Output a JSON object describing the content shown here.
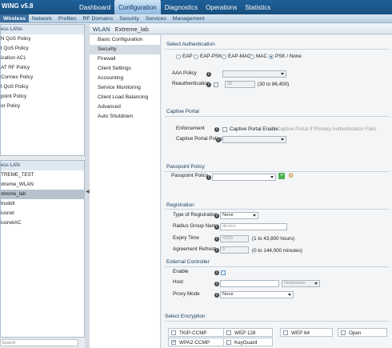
{
  "app": {
    "brand": "WiNG v5.8"
  },
  "main_nav": [
    "Dashboard",
    "Configuration",
    "Diagnostics",
    "Operations",
    "Statistics"
  ],
  "sub_nav": [
    "Wireless",
    "Network",
    "Profiles",
    "RF Domains",
    "Security",
    "Services",
    "Management"
  ],
  "left_top": {
    "header": "ess LANs",
    "items": [
      "N QoS Policy",
      "t QoS Policy",
      "ication ACL",
      "AT RF Policy",
      "Connex Policy",
      "t QoS Policy",
      "point Policy",
      "or Policy"
    ]
  },
  "left_bottom": {
    "header": "ess LAN",
    "items": [
      "TREME_TEST",
      "xtreme_WLAN",
      "xtreme_lab",
      "trudolt",
      "iusnet",
      "iusnetAC"
    ],
    "search_placeholder": "Search"
  },
  "wlan": {
    "label": "WLAN",
    "name": "Extreme_lab"
  },
  "tree_menu": [
    "Basic Configuration",
    "Security",
    "Firewall",
    "Client Settings",
    "Accounting",
    "Service Monitoring",
    "Client Load Balancing",
    "Advanced",
    "Auto Shutdown"
  ],
  "select_auth": {
    "title": "Select Authentication",
    "options": [
      "EAP",
      "EAP-PSK",
      "EAP-MAC",
      "MAC",
      "PSK / None"
    ],
    "selected": "PSK / None",
    "aaa_label": "AAA Policy",
    "reauth_label": "Reauthentication",
    "reauth_value": "30",
    "reauth_range": "(30 to 86,400)"
  },
  "captive_portal": {
    "title": "Captive Portal",
    "enforcement_label": "Enforcement",
    "enable_text": "Captive Portal Enable",
    "failure_text": "Captive Portal if Primary Authentication Fails",
    "policy_label": "Captive Portal Policy"
  },
  "passpoint": {
    "title": "Passpoint Policy",
    "policy_label": "Passpoint Policy"
  },
  "registration": {
    "title": "Registration",
    "type_label": "Type of Registration",
    "type_value": "None",
    "radius_label": "Radius Group Name",
    "radius_placeholder": "device",
    "expiry_label": "Expiry Time",
    "expiry_value": "4320",
    "expiry_range": "(1 to 43,800 hours)",
    "agreement_label": "Agreement Refresh",
    "agreement_value": "0",
    "agreement_range": "(0 to 144,000 minutes)"
  },
  "external_controller": {
    "title": "External Controller",
    "enable_label": "Enable",
    "host_label": "Host",
    "host_type": "Hostname",
    "proxy_label": "Proxy Mode",
    "proxy_value": "None"
  },
  "encryption": {
    "title": "Select Encryption",
    "options": [
      {
        "label": "TKIP-CCMP",
        "checked": false
      },
      {
        "label": "WEP 128",
        "checked": false
      },
      {
        "label": "WEP 64",
        "checked": false
      },
      {
        "label": "Open",
        "checked": false
      },
      {
        "label": "WPA2-CCMP",
        "checked": true
      },
      {
        "label": "KeyGuard",
        "checked": false
      }
    ]
  },
  "colors": {
    "topbar": "#1f5f9a",
    "subnav": "#b7cde2",
    "selected_row": "#b6c3cf"
  }
}
